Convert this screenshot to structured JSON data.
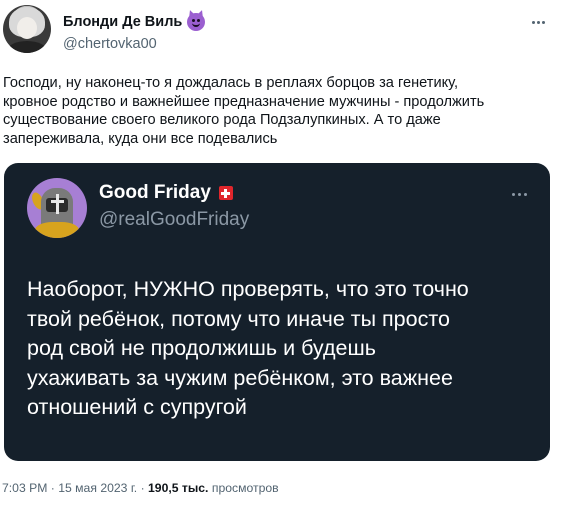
{
  "author": {
    "display_name": "Блонди Де Виль",
    "handle": "@chertovka00",
    "badge_icon": "devil-emoji-icon"
  },
  "tweet": {
    "lines": [
      "Господи, ну наконец-то я дождалась в реплаях борцов за генетику,",
      "кровное родство и важнейшее предназначение мужчины - продолжить",
      "существование своего великого рода Подзалупкиных. А то даже",
      "запереживала, куда они все подевались"
    ]
  },
  "quoted": {
    "display_name": "Good Friday",
    "badge_icon": "swiss-flag-icon",
    "handle": "@realGoodFriday",
    "lines": [
      "Наоборот, НУЖНО проверять, что это точно",
      "твой ребёнок, потому что иначе ты просто",
      "род свой не продолжишь и будешь",
      "ухаживать за чужим ребёнком, это важнее",
      "отношений с супругой"
    ],
    "background_color": "#15202b"
  },
  "meta": {
    "time": "7:03 PM",
    "separator": "·",
    "date": "15 мая 2023 г.",
    "views_count": "190,5 тыс.",
    "views_label": "просмотров"
  }
}
